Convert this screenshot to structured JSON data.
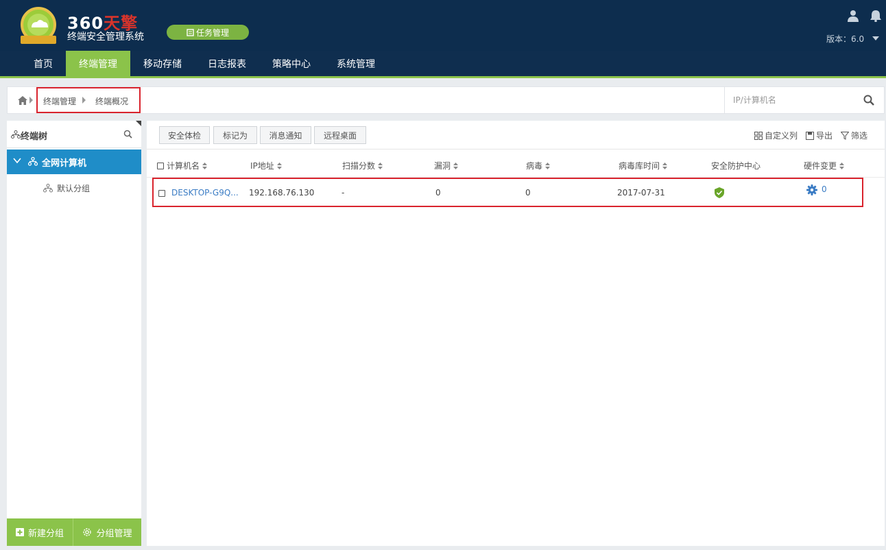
{
  "app": {
    "logo_brand": "360",
    "logo_brand_red": "天擎",
    "logo_badge_text": "360天擎",
    "subtitle": "终端安全管理系统",
    "task_button": "任务管理",
    "version_label": "版本：6.0"
  },
  "nav": {
    "items": [
      "首页",
      "终端管理",
      "移动存储",
      "日志报表",
      "策略中心",
      "系统管理"
    ],
    "active_index": 1
  },
  "breadcrumb": {
    "items": [
      "终端管理",
      "终端概况"
    ]
  },
  "search": {
    "placeholder": "IP/计算机名",
    "value": ""
  },
  "sidebar": {
    "title": "终端树",
    "root": "全网计算机",
    "children": [
      "默认分组"
    ],
    "new_group_button": "新建分组",
    "manage_group_button": "分组管理"
  },
  "toolbar": {
    "buttons": [
      "安全体检",
      "标记为",
      "消息通知",
      "远程桌面"
    ],
    "custom_columns": "自定义列",
    "export": "导出",
    "filter": "筛选"
  },
  "table": {
    "columns": [
      "计算机名",
      "IP地址",
      "扫描分数",
      "漏洞",
      "病毒",
      "病毒库时间",
      "安全防护中心",
      "硬件变更"
    ],
    "rows": [
      {
        "computer_name": "DESKTOP-G9Q...",
        "ip": "192.168.76.130",
        "scan_score": "-",
        "vulnerabilities": "0",
        "viruses": "0",
        "virus_db_time": "2017-07-31",
        "security_center_status": "shield-icon",
        "hardware_change": "0"
      }
    ]
  },
  "colors": {
    "header_bg": "#0d2d4e",
    "accent_green": "#8bc34a",
    "tree_active_blue": "#1f8dc8",
    "highlight_red": "#d9232d",
    "link_blue": "#3b7cc4"
  }
}
